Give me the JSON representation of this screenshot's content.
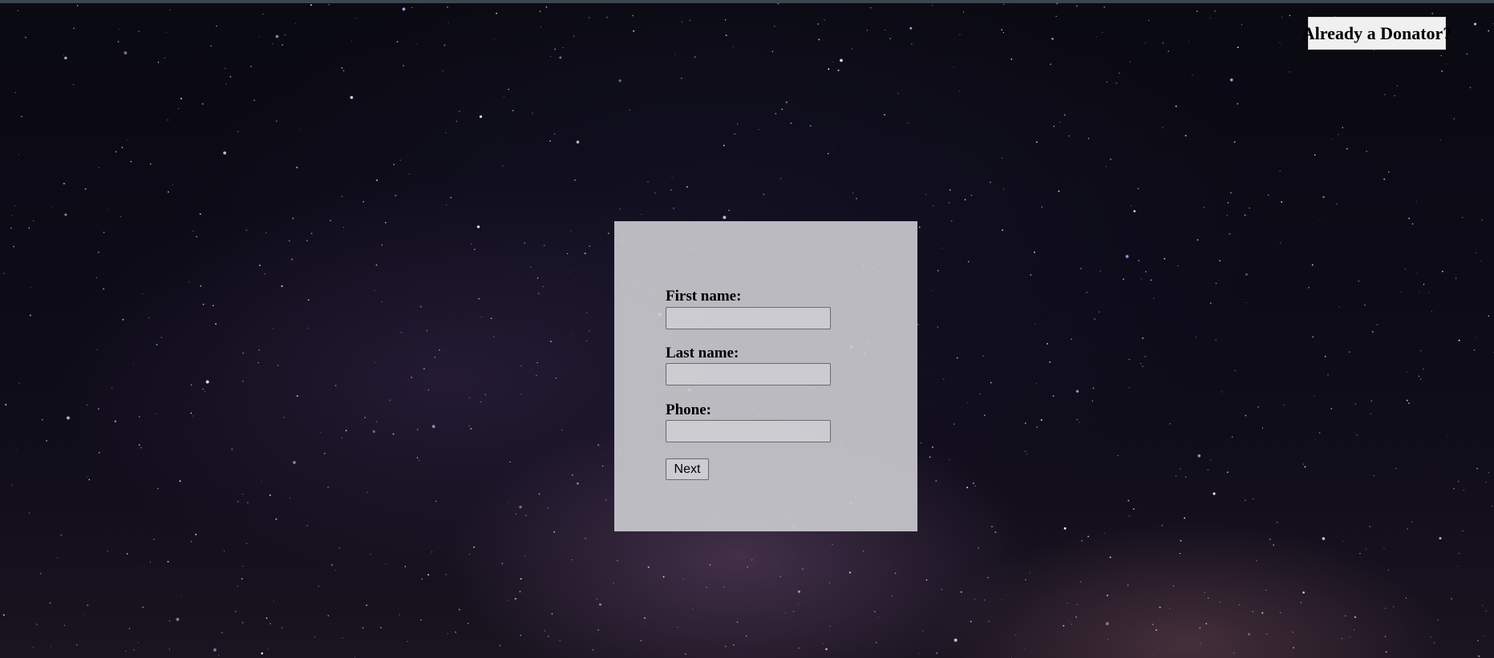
{
  "header": {
    "donator_button_label": "Already a Donator?"
  },
  "form": {
    "first_name_label": "First name:",
    "first_name_value": "",
    "last_name_label": "Last name:",
    "last_name_value": "",
    "phone_label": "Phone:",
    "phone_value": "",
    "next_label": "Next"
  },
  "colors": {
    "panel": "#cdcdd2",
    "background": "#0a0a12",
    "button": "#f0f0f0"
  }
}
